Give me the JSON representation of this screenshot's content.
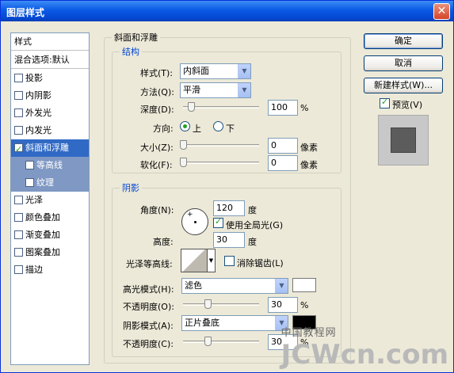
{
  "window": {
    "title": "图层样式",
    "close": "✕"
  },
  "stylelist": {
    "header": "样式",
    "blend": "混合选项:默认",
    "items": [
      {
        "label": "投影",
        "checked": false
      },
      {
        "label": "内阴影",
        "checked": false
      },
      {
        "label": "外发光",
        "checked": false
      },
      {
        "label": "内发光",
        "checked": false
      },
      {
        "label": "斜面和浮雕",
        "checked": true
      },
      {
        "label": "等高线",
        "checked": false
      },
      {
        "label": "纹理",
        "checked": false
      },
      {
        "label": "光泽",
        "checked": false
      },
      {
        "label": "颜色叠加",
        "checked": false
      },
      {
        "label": "渐变叠加",
        "checked": false
      },
      {
        "label": "图案叠加",
        "checked": false
      },
      {
        "label": "描边",
        "checked": false
      }
    ]
  },
  "bevel": {
    "title": "斜面和浮雕",
    "structure": {
      "title": "结构",
      "style_label": "样式(T):",
      "style_value": "内斜面",
      "method_label": "方法(Q):",
      "method_value": "平滑",
      "depth_label": "深度(D):",
      "depth_value": "100",
      "depth_unit": "%",
      "direction_label": "方向:",
      "dir_up": "上",
      "dir_down": "下",
      "size_label": "大小(Z):",
      "size_value": "0",
      "size_unit": "像素",
      "soften_label": "软化(F):",
      "soften_value": "0",
      "soften_unit": "像素"
    },
    "shading": {
      "title": "阴影",
      "angle_label": "角度(N):",
      "angle_value": "120",
      "angle_unit": "度",
      "global_light_label": "使用全局光(G)",
      "altitude_label": "高度:",
      "altitude_value": "30",
      "altitude_unit": "度",
      "gloss_label": "光泽等高线:",
      "antialias_label": "消除锯齿(L)",
      "highlight_mode_label": "高光模式(H):",
      "highlight_mode_value": "滤色",
      "highlight_color": "#ffffff",
      "highlight_opacity_label": "不透明度(O):",
      "highlight_opacity_value": "30",
      "highlight_opacity_unit": "%",
      "shadow_mode_label": "阴影模式(A):",
      "shadow_mode_value": "正片叠底",
      "shadow_color": "#000000",
      "shadow_opacity_label": "不透明度(C):",
      "shadow_opacity_value": "30",
      "shadow_opacity_unit": "%"
    }
  },
  "buttons": {
    "ok": "确定",
    "cancel": "取消",
    "new_style": "新建样式(W)...",
    "preview": "预览(V)"
  },
  "watermark": {
    "cn": "中国教程网",
    "big": "JCWcn.com"
  }
}
